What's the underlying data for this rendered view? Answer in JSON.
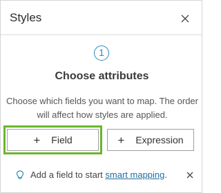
{
  "panel": {
    "title": "Styles"
  },
  "step": {
    "number": "1",
    "heading": "Choose attributes"
  },
  "description": "Choose which fields you want to map. The order will affect how styles are applied.",
  "buttons": {
    "field": {
      "icon": "+",
      "label": "Field",
      "highlighted": true
    },
    "expression": {
      "icon": "+",
      "label": "Expression"
    }
  },
  "tip": {
    "icon": "lightbulb-icon",
    "prefix": "Add a field to start ",
    "link": "smart mapping",
    "suffix": ".",
    "dismiss_icon": "close-icon"
  },
  "colors": {
    "accent": "#2a8ab8",
    "highlight": "#6bb52b",
    "link": "#1f6fa0"
  }
}
